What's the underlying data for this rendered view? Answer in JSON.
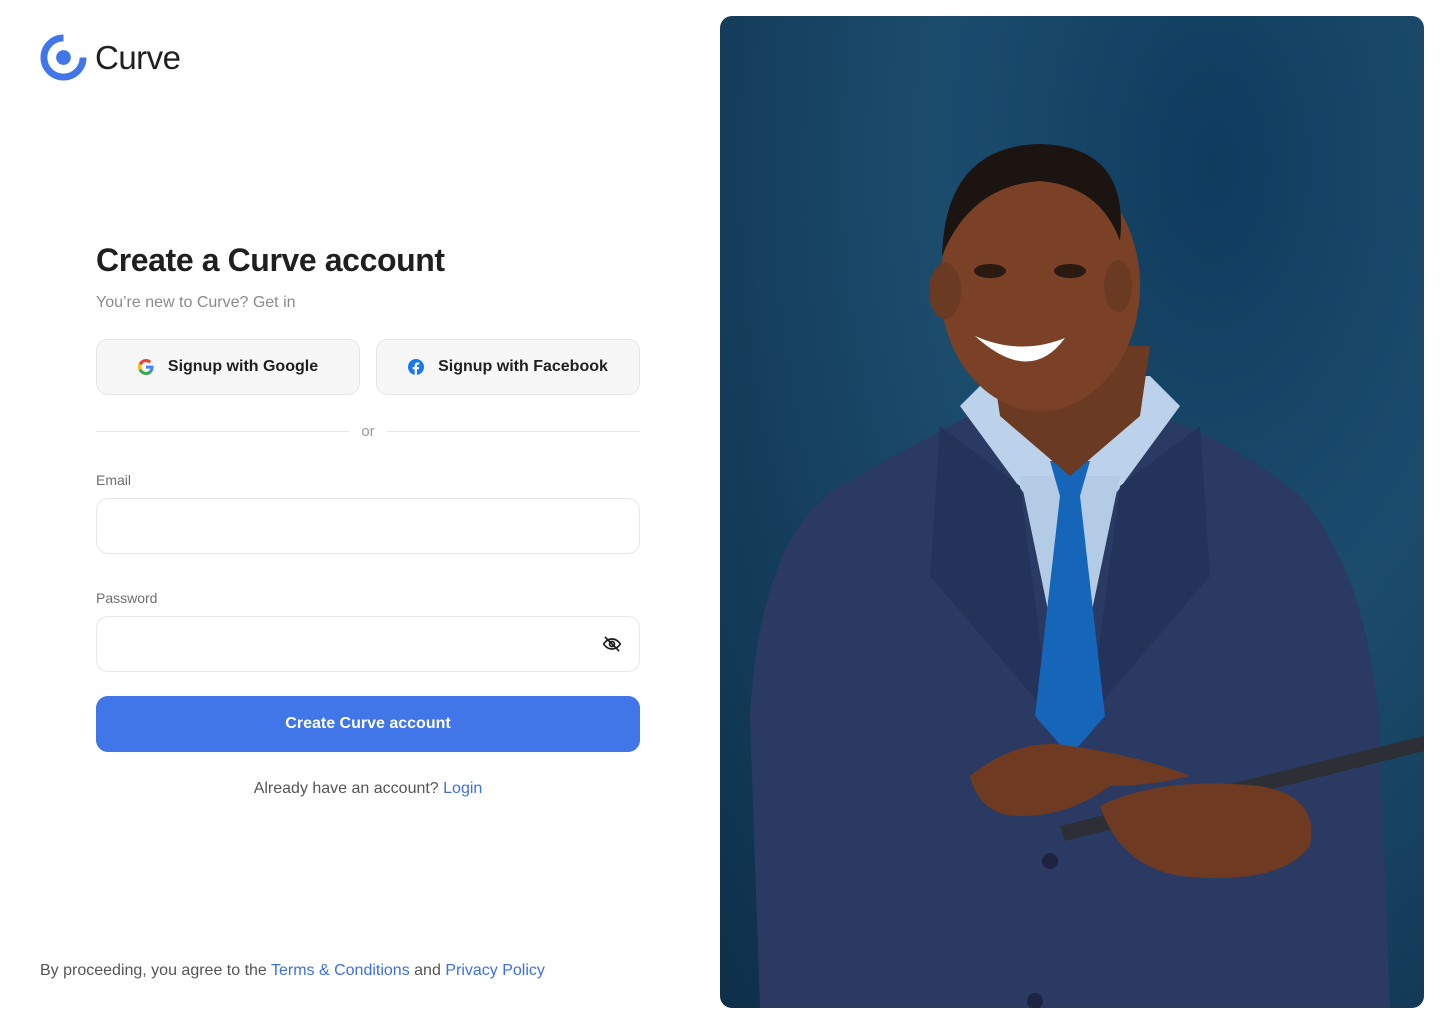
{
  "brand": {
    "name": "Curve",
    "accent_color": "#4176e8",
    "logo_icon": "curve-logo-icon"
  },
  "form": {
    "title": "Create a Curve account",
    "subtitle": "You’re new to Curve? Get in",
    "google_button": {
      "label": "Signup with Google",
      "icon": "google-icon"
    },
    "facebook_button": {
      "label": "Signup with Facebook",
      "icon": "facebook-icon"
    },
    "divider_text": "or",
    "email": {
      "label": "Email",
      "value": "",
      "placeholder": ""
    },
    "password": {
      "label": "Password",
      "value": "",
      "placeholder": "",
      "toggle_icon": "eye-off-icon"
    },
    "submit_label": "Create Curve account",
    "login_prompt": "Already have an account?",
    "login_link": "Login"
  },
  "footer": {
    "prefix": "By proceeding, you agree to the",
    "terms_link": "Terms & Conditions",
    "conjunction": "and",
    "privacy_link": "Privacy Policy"
  }
}
